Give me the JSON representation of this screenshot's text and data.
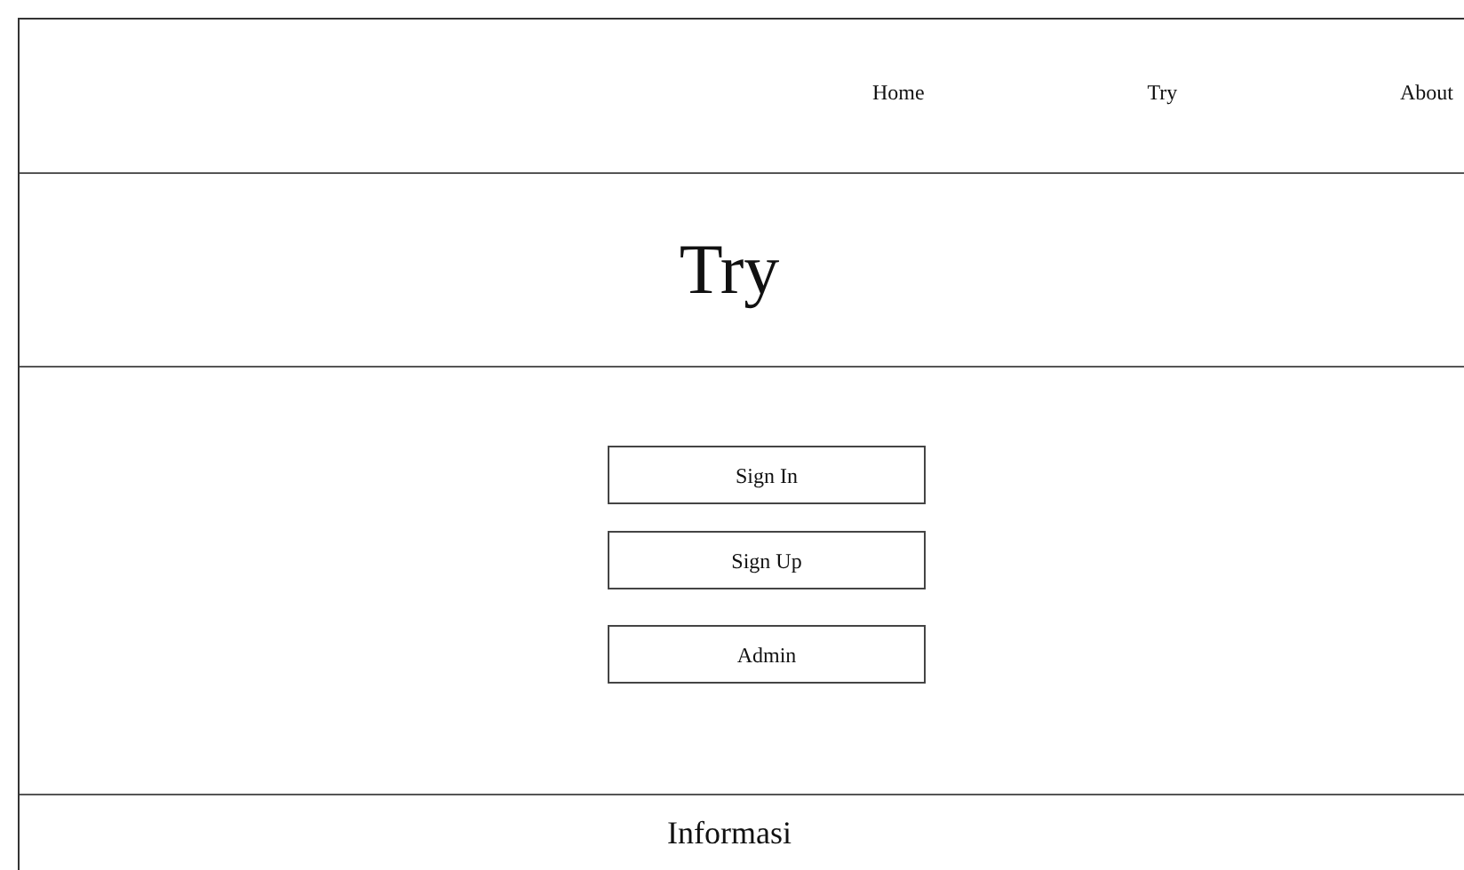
{
  "nav": {
    "items": [
      "Home",
      "Try",
      "About"
    ]
  },
  "header": {
    "title": "Try"
  },
  "buttons": [
    "Sign In",
    "Sign Up",
    "Admin"
  ],
  "footer": {
    "title": "Informasi"
  }
}
